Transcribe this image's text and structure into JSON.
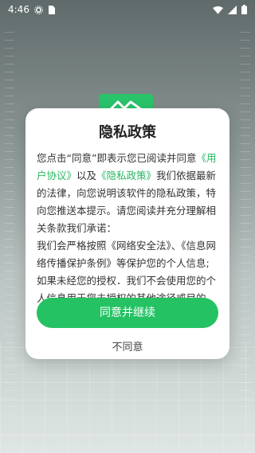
{
  "status_bar": {
    "time": "4:46"
  },
  "dialog": {
    "title": "隐私政策",
    "body_prefix": "您点击“同意”即表示您已阅读并同意",
    "link_user_agreement": "《用户协议》",
    "body_mid": "以及",
    "link_privacy_policy": "《隐私政策》",
    "body_after_links": "我们依据最新的法律，向您说明该软件的隐私政策，特向您推送本提示。请您阅读并充分理解相关条款我们承诺：",
    "body_promise_1": "我们会严格按照《网络安全法》、《信息网络传播保护条例》等保护您的个人信息;",
    "body_promise_2": "如果未经您的授权．我们不会使用您的个人信息用于您未授权的其他途径或目的。",
    "agree_button": "同意并继续",
    "decline_button": "不同意"
  },
  "colors": {
    "accent": "#25c264",
    "link": "#25b860"
  }
}
